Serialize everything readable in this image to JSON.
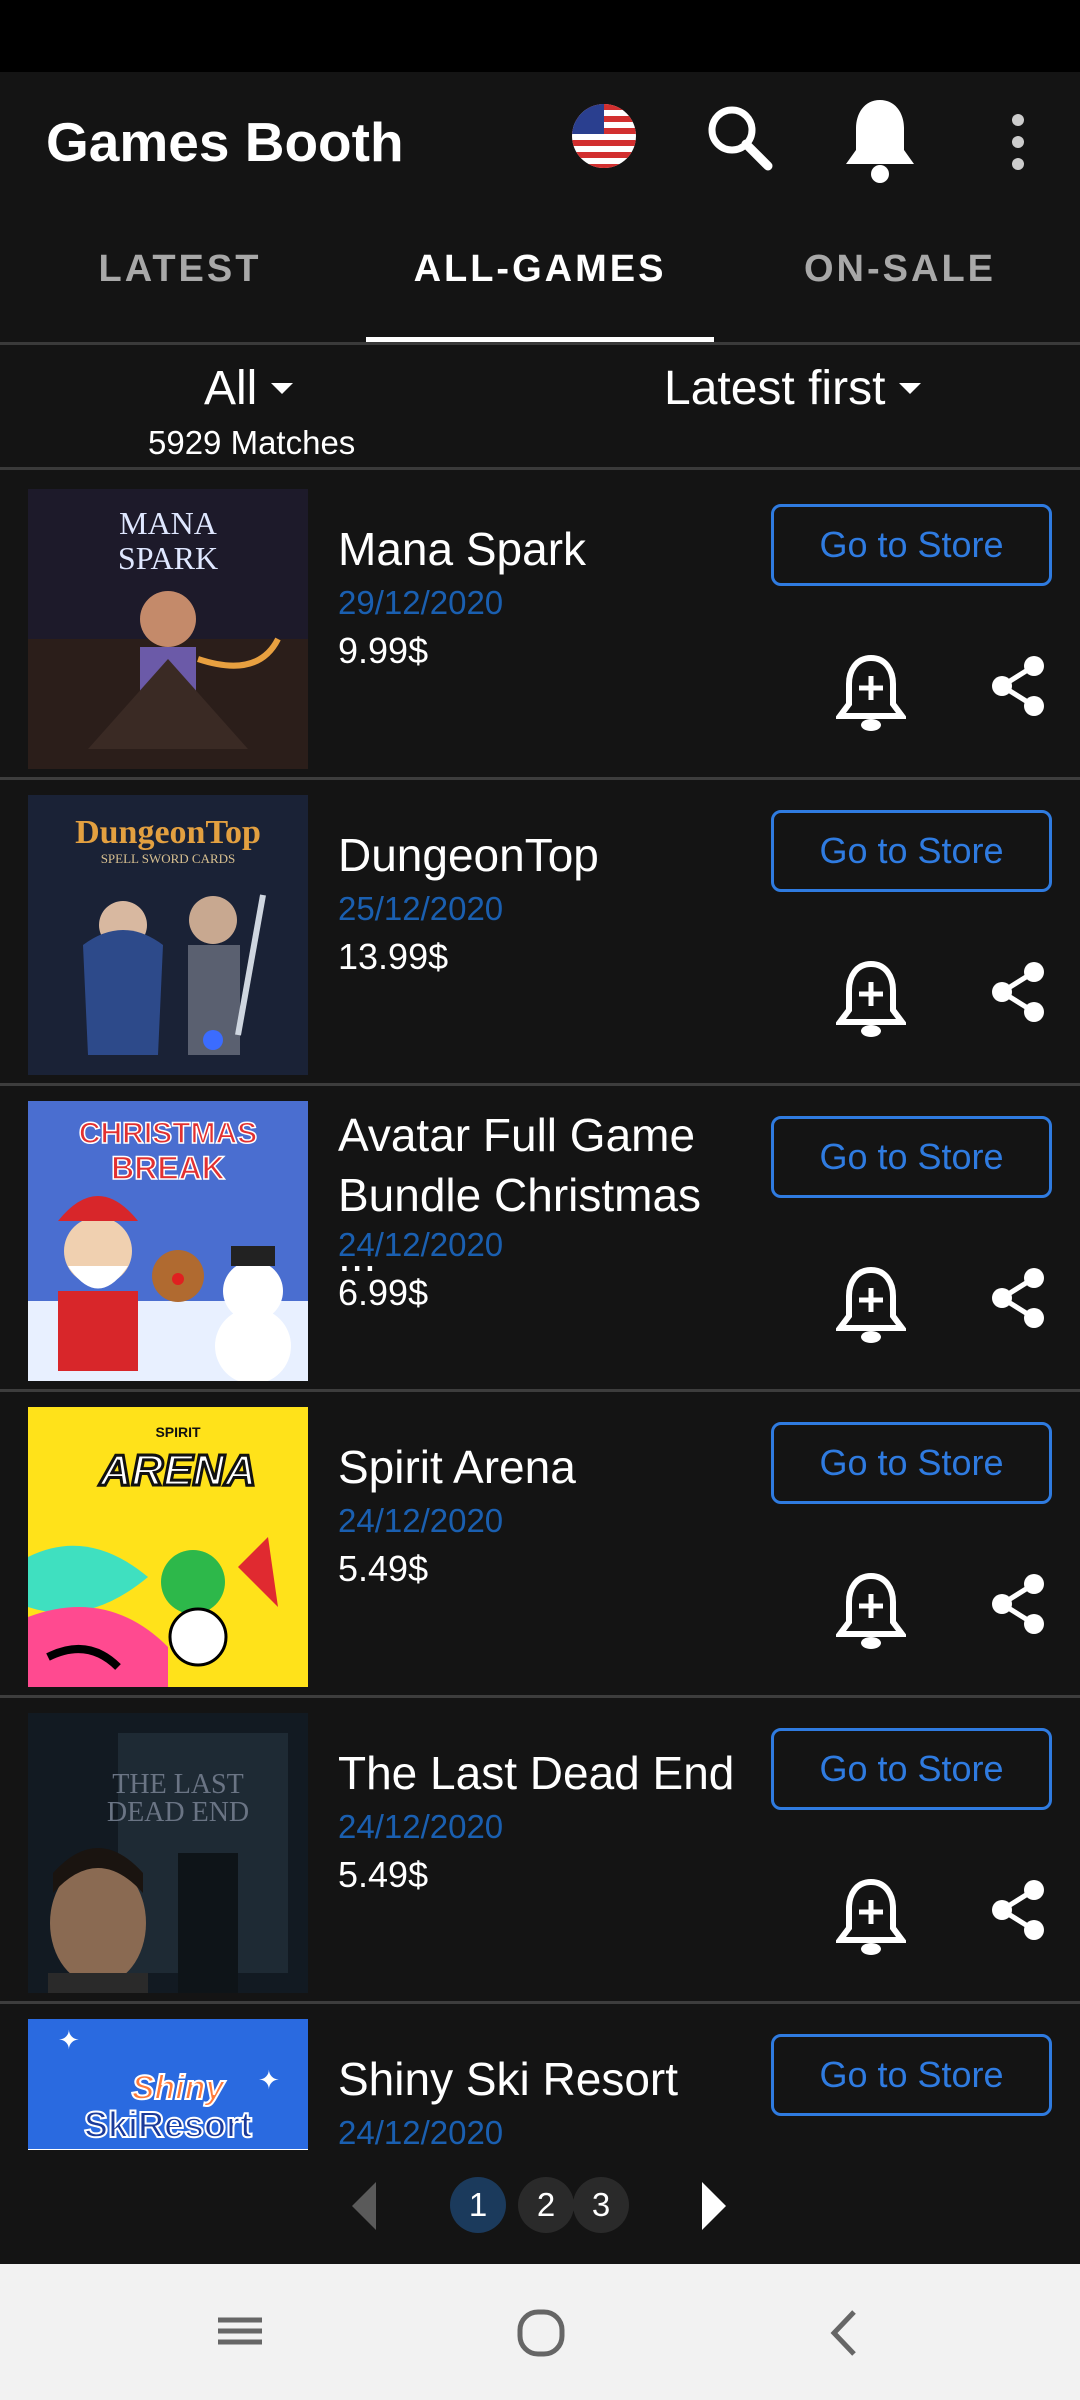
{
  "app": {
    "title": "Games Booth"
  },
  "tabs": [
    {
      "label": "LATEST"
    },
    {
      "label": "ALL-GAMES"
    },
    {
      "label": "ON-SALE"
    }
  ],
  "filters": {
    "category": "All",
    "sort": "Latest first",
    "matches": "5929 Matches"
  },
  "games": [
    {
      "title": "Mana Spark",
      "date": "29/12/2020",
      "price": "9.99$",
      "store_label": "Go to Store",
      "thumb_text": "MANA SPARK"
    },
    {
      "title": "DungeonTop",
      "date": "25/12/2020",
      "price": "13.99$",
      "store_label": "Go to Store",
      "thumb_text": "DungeonTop",
      "thumb_sub": "SPELL SWORD CARDS"
    },
    {
      "title": "Avatar Full Game Bundle Christmas ...",
      "date": "24/12/2020",
      "price": "6.99$",
      "store_label": "Go to Store",
      "thumb_text": "CHRISTMAS BREAK"
    },
    {
      "title": "Spirit Arena",
      "date": "24/12/2020",
      "price": "5.49$",
      "store_label": "Go to Store",
      "thumb_text": "ARENA",
      "thumb_sub": "SPIRIT"
    },
    {
      "title": "The Last Dead End",
      "date": "24/12/2020",
      "price": "5.49$",
      "store_label": "Go to Store",
      "thumb_text": "THE LAST DEAD END"
    },
    {
      "title": "Shiny Ski Resort",
      "date": "24/12/2020",
      "price": "",
      "store_label": "Go to Store",
      "thumb_text": "Shiny SkiResort"
    }
  ],
  "pagination": {
    "pages": [
      "1",
      "2",
      "3"
    ],
    "current": "1"
  },
  "colors": {
    "accent": "#2f7be0",
    "date": "#1a5fb0",
    "background": "#141414"
  }
}
